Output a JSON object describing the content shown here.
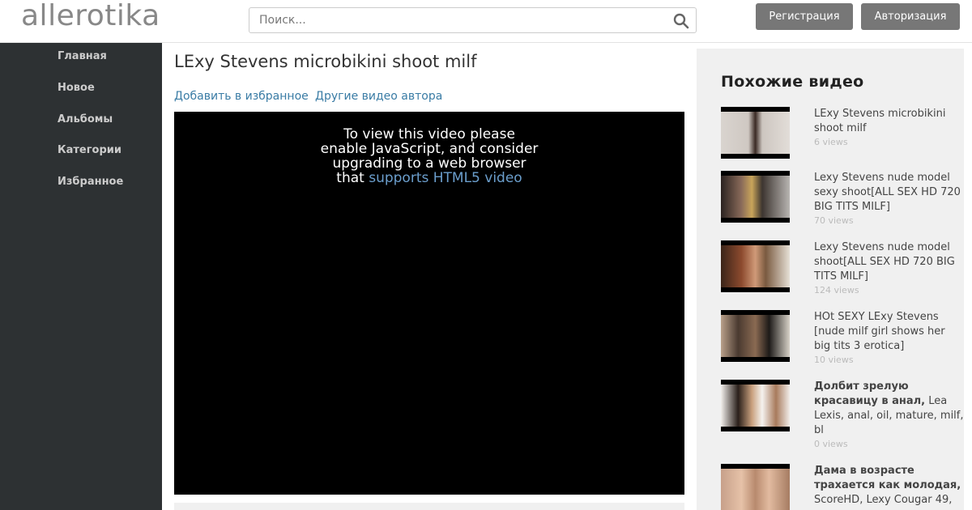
{
  "site": {
    "logo": "allerotika"
  },
  "search": {
    "placeholder": "Поиск..."
  },
  "header": {
    "register_label": "Регистрация",
    "login_label": "Авторизация"
  },
  "sidebar": {
    "items": [
      {
        "label": "Главная"
      },
      {
        "label": "Новое"
      },
      {
        "label": "Альбомы"
      },
      {
        "label": "Категории"
      },
      {
        "label": "Избранное"
      }
    ]
  },
  "video": {
    "title": "LExy Stevens microbikini shoot milf",
    "add_favorite": "Добавить в избранное",
    "other_videos": "Другие видео автора",
    "player_message_pre": "To view this video please enable JavaScript, and consider upgrading to a web browser that",
    "player_message_link": "supports HTML5 video"
  },
  "related": {
    "heading": "Похожие видео",
    "items": [
      {
        "title": "LExy Stevens microbikini shoot milf",
        "bold": "",
        "rest": "",
        "views": "6 views"
      },
      {
        "title": "Lexy Stevens nude model sexy shoot[ALL SEX HD 720 BIG TITS MILF]",
        "bold": "",
        "rest": "",
        "views": "70 views"
      },
      {
        "title": "Lexy Stevens nude model shoot[ALL SEX HD 720 BIG TITS MILF]",
        "bold": "",
        "rest": "",
        "views": "124 views"
      },
      {
        "title": "HOt SEXY LExy Stevens [nude milf girl shows her big tits 3 erotica]",
        "bold": "",
        "rest": "",
        "views": "10 views"
      },
      {
        "title": "",
        "bold": "Долбит зрелую красавицу в анал,",
        "rest": " Lea Lexis, anal, oil, mature, milf, bl",
        "views": "0 views"
      },
      {
        "title": "",
        "bold": "Дама в возрасте трахается как молодая,",
        "rest": " ScoreHD, Lexy Cougar 49,",
        "views": ""
      }
    ]
  }
}
